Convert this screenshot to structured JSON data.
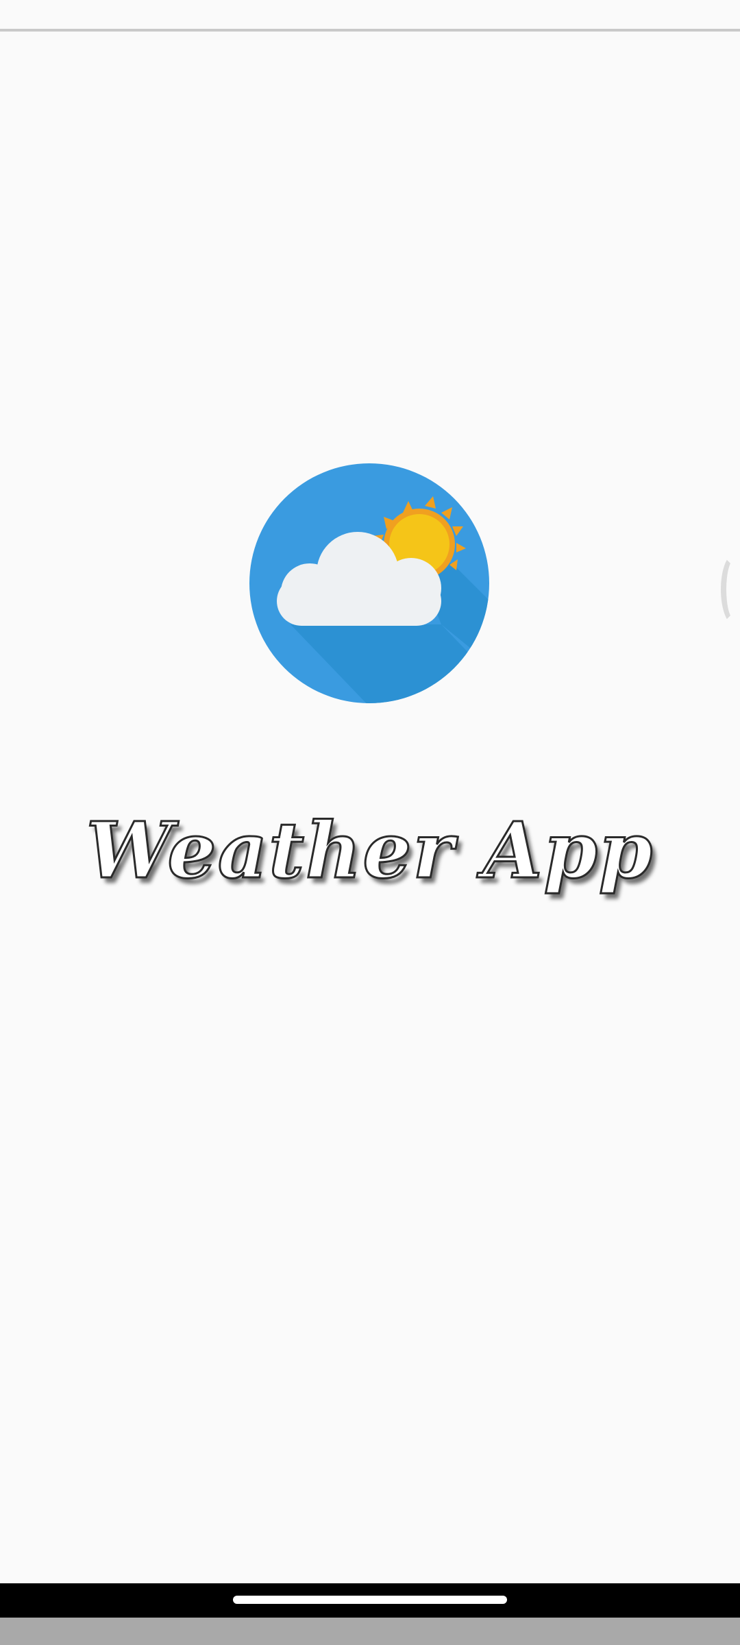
{
  "splash": {
    "title": "Weather App",
    "logo_icon": "cloud-sun-icon"
  },
  "colors": {
    "background": "#fafafa",
    "logo_circle": "#3a9be0",
    "logo_shadow": "#2a8fd0",
    "cloud": "#eef1f3",
    "sun": "#f5c518",
    "sun_rays": "#f0a020",
    "nav_bar": "#000000",
    "bottom_strip": "#a9a9a9"
  },
  "system": {
    "nav_handle_icon": "home-handle-icon"
  }
}
